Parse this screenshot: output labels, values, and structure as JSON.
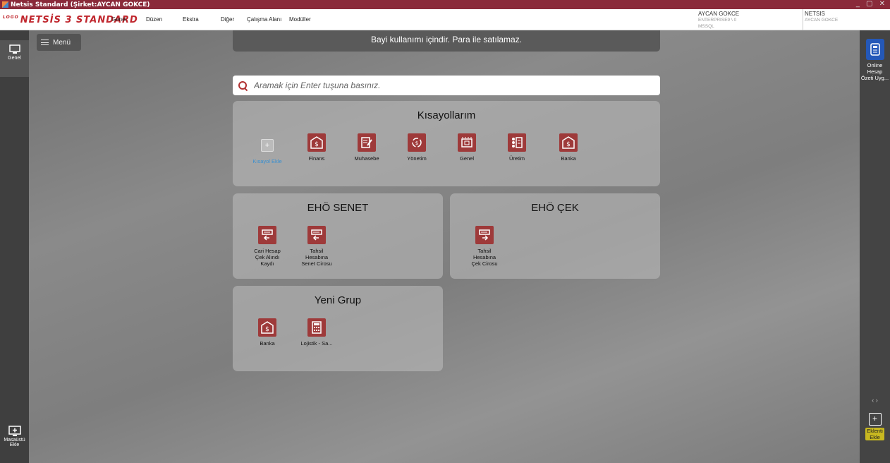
{
  "window": {
    "title": "Netsis Standard (Şirket:AYCAN GOKCE)",
    "controls": "_ ▢ ✕"
  },
  "logo": {
    "sub": "LOGO",
    "text": "NETSİS 3 STANDARD"
  },
  "menubar": {
    "items": [
      "Genel",
      "Düzen",
      "Ekstra",
      "Diğer",
      "Çalışma Alanı",
      "Modüller"
    ]
  },
  "user": {
    "name": "AYCAN GOKCE",
    "db": "ENTERPRISE9 \\ 0",
    "server": "MSSQL",
    "app": "NETSIS",
    "app_user": "AYCAN GOKCE"
  },
  "left_dock": {
    "top_tile": "Genel",
    "bottom_tile": [
      "Masaüstü",
      "Ekle"
    ]
  },
  "main": {
    "menu_label": "Menü",
    "banner": "Bayi kullanımı içindir. Para ile satılamaz.",
    "search_placeholder": "Aramak için Enter tuşuna basınız."
  },
  "panels": {
    "kisayollar": {
      "title": "Kısayollarım",
      "tiles": [
        "Kısayol Ekle",
        "Finans",
        "Muhasebe",
        "Yönetim",
        "Genel",
        "Üretim",
        "Banka"
      ]
    },
    "senet": {
      "title": "EHÖ SENET",
      "tiles": [
        [
          "Cari Hesap",
          "Çek Alındı",
          "Kaydı"
        ],
        [
          "Tahsil",
          "Hesabına",
          "Senet Cirosu"
        ]
      ]
    },
    "cek": {
      "title": "EHÖ ÇEK",
      "tiles": [
        [
          "Tahsil",
          "Hesabına",
          "Çek Cirosu"
        ]
      ]
    },
    "yeni_grup": {
      "title": "Yeni Grup",
      "tiles": [
        "Banka",
        "Lojistik - Sa..."
      ]
    }
  },
  "right_dock": {
    "app_tile": [
      "Online",
      "Hesap",
      "Özeti Uyg..."
    ],
    "nav": "‹   ›",
    "add_tile": [
      "Eklenti",
      "Ekle"
    ]
  },
  "colors": {
    "accent": "#9e3a3a",
    "titlebar": "#8a2a3a",
    "logo": "#c0262d"
  }
}
